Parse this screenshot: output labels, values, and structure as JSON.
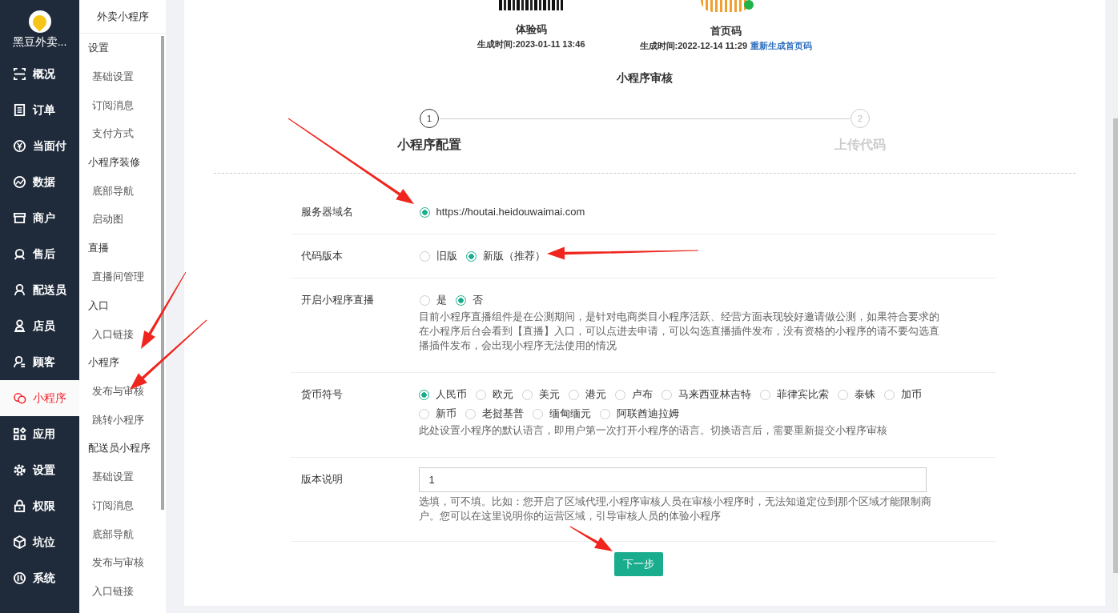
{
  "brand": {
    "name": "黑豆外卖..."
  },
  "nav": [
    {
      "label": "概况",
      "selected": false
    },
    {
      "label": "订单",
      "selected": false
    },
    {
      "label": "当面付",
      "selected": false
    },
    {
      "label": "数据",
      "selected": false
    },
    {
      "label": "商户",
      "selected": false
    },
    {
      "label": "售后",
      "selected": false
    },
    {
      "label": "配送员",
      "selected": false
    },
    {
      "label": "店员",
      "selected": false
    },
    {
      "label": "顾客",
      "selected": false
    },
    {
      "label": "小程序",
      "selected": true
    },
    {
      "label": "应用",
      "selected": false
    },
    {
      "label": "设置",
      "selected": false
    },
    {
      "label": "权限",
      "selected": false
    },
    {
      "label": "坑位",
      "selected": false
    },
    {
      "label": "系统",
      "selected": false
    }
  ],
  "submenu": {
    "title": "外卖小程序",
    "groups": [
      {
        "label": "设置",
        "children": [
          {
            "label": "基础设置"
          },
          {
            "label": "订阅消息"
          },
          {
            "label": "支付方式"
          }
        ]
      },
      {
        "label": "小程序装修",
        "children": [
          {
            "label": "底部导航"
          },
          {
            "label": "启动图"
          }
        ]
      },
      {
        "label": "直播",
        "children": [
          {
            "label": "直播间管理"
          }
        ]
      },
      {
        "label": "入口",
        "children": [
          {
            "label": "入口链接"
          }
        ]
      },
      {
        "label": "小程序",
        "children": [
          {
            "label": "发布与审核"
          },
          {
            "label": "跳转小程序"
          }
        ]
      },
      {
        "label": "配送员小程序",
        "children": [
          {
            "label": "基础设置"
          },
          {
            "label": "订阅消息"
          },
          {
            "label": "底部导航"
          },
          {
            "label": "发布与审核"
          },
          {
            "label": "入口链接"
          }
        ]
      }
    ]
  },
  "codes": [
    {
      "kind": "qr",
      "title": "体验码",
      "time": "生成时间:2023-01-11 13:46"
    },
    {
      "kind": "sun",
      "title": "首页码",
      "time": "生成时间:2022-12-14 11:29",
      "link": "重新生成首页码"
    }
  ],
  "section_title": "小程序审核",
  "steps": [
    {
      "number": "1",
      "label": "小程序配置",
      "selected": true
    },
    {
      "number": "2",
      "label": "上传代码",
      "selected": false
    }
  ],
  "form": [
    {
      "kind": "radio",
      "label": "服务器域名",
      "options": [
        {
          "label": "https://houtai.heidouwaimai.com",
          "selected": true
        }
      ]
    },
    {
      "kind": "radio",
      "label": "代码版本",
      "options": [
        {
          "label": "旧版",
          "selected": false
        },
        {
          "label": "新版（推荐）",
          "selected": true
        }
      ]
    },
    {
      "kind": "radio",
      "label": "开启小程序直播",
      "options": [
        {
          "label": "是",
          "selected": false
        },
        {
          "label": "否",
          "selected": true
        }
      ],
      "hint": "目前小程序直播组件是在公测期间，是针对电商类目小程序活跃、经营方面表现较好邀请做公测，如果符合要求的在小程序后台会看到【直播】入口，可以点进去申请，可以勾选直播插件发布，没有资格的小程序的请不要勾选直播插件发布，会出现小程序无法使用的情况"
    },
    {
      "kind": "radio",
      "label": "货币符号",
      "options": [
        {
          "label": "人民币",
          "selected": true
        },
        {
          "label": "欧元",
          "selected": false
        },
        {
          "label": "美元",
          "selected": false
        },
        {
          "label": "港元",
          "selected": false
        },
        {
          "label": "卢布",
          "selected": false
        },
        {
          "label": "马来西亚林吉特",
          "selected": false
        },
        {
          "label": "菲律宾比索",
          "selected": false
        },
        {
          "label": "泰铢",
          "selected": false
        },
        {
          "label": "加币",
          "selected": false
        },
        {
          "label": "新币",
          "selected": false
        },
        {
          "label": "老挝基普",
          "selected": false
        },
        {
          "label": "缅甸缅元",
          "selected": false
        },
        {
          "label": "阿联酋迪拉姆",
          "selected": false
        }
      ],
      "hint": "此处设置小程序的默认语言，即用户第一次打开小程序的语言。切换语言后，需要重新提交小程序审核"
    },
    {
      "kind": "text",
      "label": "版本说明",
      "value": "1",
      "hint": "选填，可不填。比如：您开启了区域代理,小程序审核人员在审核小程序时，无法知道定位到那个区域才能限制商户。您可以在这里说明你的运营区域，引导审核人员的体验小程序"
    }
  ],
  "next_button": "下一步"
}
